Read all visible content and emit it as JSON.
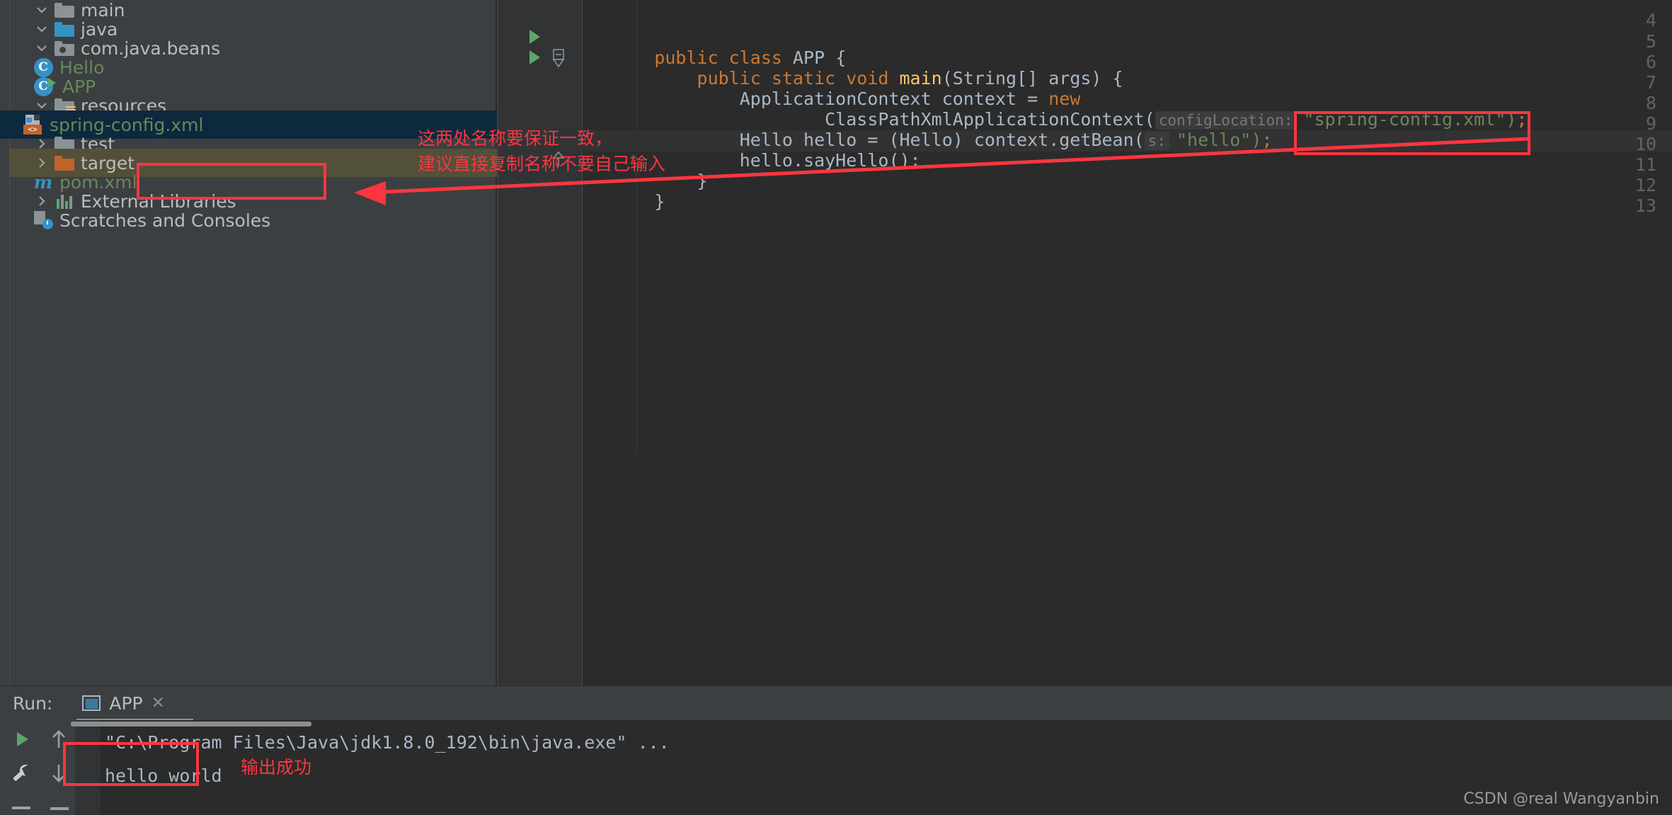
{
  "project_tree": {
    "items": [
      {
        "label": "main",
        "icon": "folder-grey-icon",
        "twisty": "chevron-down",
        "indent": 58,
        "color": "grey",
        "state": "normal"
      },
      {
        "label": "java",
        "icon": "folder-blue-icon",
        "twisty": "chevron-down",
        "indent": 82,
        "color": "grey",
        "state": "normal"
      },
      {
        "label": "com.java.beans",
        "icon": "package-icon",
        "twisty": "chevron-down",
        "indent": 106,
        "color": "grey",
        "state": "normal"
      },
      {
        "label": "Hello",
        "icon": "java-class-icon",
        "twisty": "none",
        "indent": 130,
        "color": "green",
        "state": "normal"
      },
      {
        "label": "APP",
        "icon": "java-class-runnable-icon",
        "twisty": "none",
        "indent": 106,
        "color": "green",
        "state": "normal"
      },
      {
        "label": "resources",
        "icon": "folder-resources-icon",
        "twisty": "chevron-down",
        "indent": 82,
        "color": "grey",
        "state": "normal"
      },
      {
        "label": "spring-config.xml",
        "icon": "xml-file-icon",
        "twisty": "none",
        "indent": 130,
        "color": "green",
        "state": "selected"
      },
      {
        "label": "test",
        "icon": "folder-grey-icon",
        "twisty": "chevron-right",
        "indent": 58,
        "color": "grey",
        "state": "normal"
      },
      {
        "label": "target",
        "icon": "folder-orange-icon",
        "twisty": "chevron-right",
        "indent": 34,
        "color": "grey",
        "state": "target"
      },
      {
        "label": "pom.xml",
        "icon": "maven-m-icon",
        "twisty": "none",
        "indent": 58,
        "color": "green",
        "state": "normal"
      },
      {
        "label": "External Libraries",
        "icon": "libraries-icon",
        "twisty": "chevron-right",
        "indent": 10,
        "color": "grey",
        "state": "normal"
      },
      {
        "label": "Scratches and Consoles",
        "icon": "scratches-icon",
        "twisty": "none",
        "indent": 34,
        "color": "grey",
        "state": "normal"
      }
    ]
  },
  "editor": {
    "gutter_numbers": [
      "4",
      "5",
      "6",
      "7",
      "8",
      "9",
      "10",
      "11",
      "12",
      "13"
    ],
    "lines": [
      {
        "n": "5",
        "segments": [
          {
            "t": "public ",
            "c": "kw"
          },
          {
            "t": "class ",
            "c": "kw"
          },
          {
            "t": "APP ",
            "c": "plain"
          },
          {
            "t": "{",
            "c": "plain"
          }
        ]
      },
      {
        "n": "6",
        "segments": [
          {
            "t": "    public static void ",
            "c": "kw"
          },
          {
            "t": "main",
            "c": "mth"
          },
          {
            "t": "(String[] args) {",
            "c": "plain"
          }
        ]
      },
      {
        "n": "7",
        "segments": [
          {
            "t": "        ApplicationContext context = ",
            "c": "plain"
          },
          {
            "t": "new",
            "c": "kw"
          }
        ]
      },
      {
        "n": "8",
        "segments": [
          {
            "t": "                ClassPathXmlApplicationContext(",
            "c": "plain"
          }
        ]
      },
      {
        "n": "9",
        "segments": [
          {
            "t": "        Hello hello = (Hello) context.getBean(",
            "c": "plain"
          }
        ]
      },
      {
        "n": "10",
        "segments": [
          {
            "t": "        hello.sayHello();",
            "c": "plain"
          }
        ]
      },
      {
        "n": "11",
        "segments": [
          {
            "t": "    }",
            "c": "plain"
          }
        ]
      },
      {
        "n": "12",
        "segments": [
          {
            "t": "}",
            "c": "plain"
          }
        ]
      }
    ],
    "param_hint_config_location": "configLocation:",
    "config_location_value": "\"spring-config.xml\")",
    "config_location_semicolon": ";",
    "param_hint_s": "s:",
    "get_bean_value": "\"hello\")",
    "get_bean_semicolon": ";",
    "run_markers_on_lines": [
      "5",
      "6"
    ]
  },
  "annotations": {
    "note_line1": "这两处名称要保证一致，",
    "note_line2": "建议直接复制名称不要自己输入",
    "output_note": "输出成功",
    "highlight_color": "#fb3640"
  },
  "run_panel": {
    "run_label": "Run:",
    "tab_label": "APP",
    "tab_close": "✕",
    "console_lines": [
      "\"C:\\Program Files\\Java\\jdk1.8.0_192\\bin\\java.exe\" ...",
      "hello world"
    ],
    "toolbar_icons": [
      "run-icon",
      "wrench-icon",
      "arrow-up-icon",
      "arrow-down-icon",
      "minus-icon"
    ]
  },
  "watermark": {
    "text": "CSDN @real Wangyanbin"
  }
}
